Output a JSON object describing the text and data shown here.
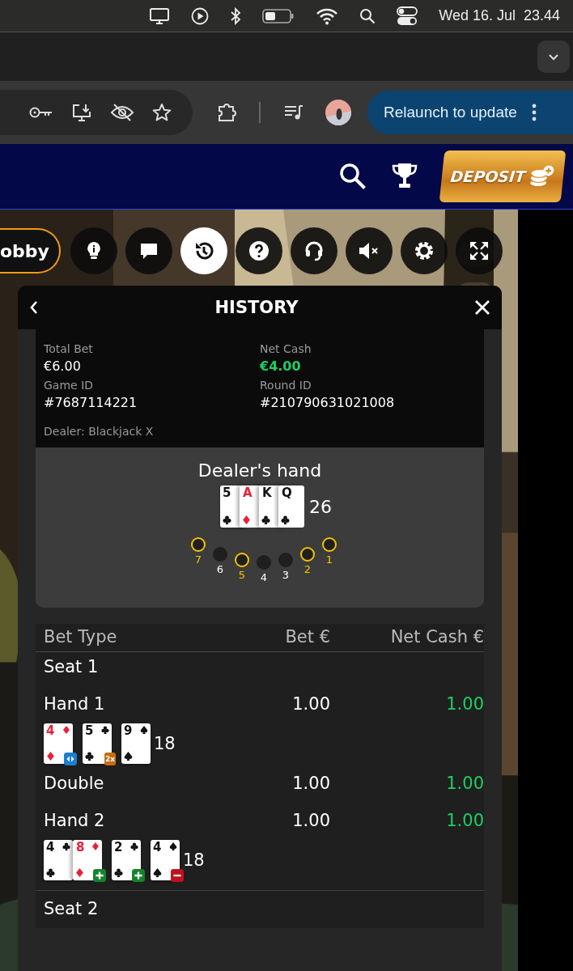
{
  "menubar": {
    "date": "Wed 16. Jul",
    "time": "23.44"
  },
  "browser": {
    "update_button": "Relaunch to update"
  },
  "site_header": {
    "deposit_button": "DEPOSIT"
  },
  "game_toolbar": {
    "lobby_button": "obby",
    "buttons": [
      {
        "kind": "tips",
        "selected": false
      },
      {
        "kind": "chat",
        "selected": false
      },
      {
        "kind": "history",
        "selected": true
      },
      {
        "kind": "help",
        "selected": false
      },
      {
        "kind": "support",
        "selected": false
      },
      {
        "kind": "sound",
        "selected": false
      },
      {
        "kind": "settings",
        "selected": false
      },
      {
        "kind": "fullscreen",
        "selected": false
      }
    ]
  },
  "history": {
    "title": "HISTORY",
    "summary": [
      {
        "label": "Total Bet",
        "value": "€6.00",
        "positive": false
      },
      {
        "label": "Net Cash",
        "value": "€4.00",
        "positive": true
      },
      {
        "label": "Game ID",
        "value": "#7687114221",
        "positive": false
      },
      {
        "label": "Round ID",
        "value": "#210790631021008",
        "positive": false
      }
    ],
    "dealer_line": "Dealer: Blackjack X",
    "dealer_hand": {
      "title": "Dealer's hand",
      "total": "26",
      "cards": [
        {
          "rank": "5",
          "kind": "clubs",
          "overlap": false
        },
        {
          "rank": "A",
          "kind": "diamonds",
          "overlap": true
        },
        {
          "rank": "K",
          "kind": "clubs",
          "overlap": true
        },
        {
          "rank": "Q",
          "kind": "clubs",
          "overlap": true
        }
      ],
      "seats": [
        {
          "number": "7",
          "active": true
        },
        {
          "number": "6",
          "active": false
        },
        {
          "number": "5",
          "active": true
        },
        {
          "number": "4",
          "active": false
        },
        {
          "number": "3",
          "active": false
        },
        {
          "number": "2",
          "active": true
        },
        {
          "number": "1",
          "active": true
        }
      ]
    },
    "table": {
      "columns": [
        "Bet Type",
        "Bet €",
        "Net Cash €"
      ],
      "rows": [
        {
          "kind": "seat",
          "label": "Seat 1"
        },
        {
          "kind": "bet",
          "label": "Hand 1",
          "bet": "1.00",
          "net": "1.00",
          "positive": true
        },
        {
          "kind": "cards",
          "total": "18",
          "cards": [
            {
              "rank": "4",
              "kind": "diamonds",
              "overlap": false,
              "badge": {
                "kind": "split"
              }
            },
            {
              "rank": "5",
              "kind": "clubs",
              "overlap": false,
              "badge": {
                "kind": "double",
                "text": "2x"
              }
            },
            {
              "rank": "9",
              "kind": "spades",
              "overlap": false
            }
          ]
        },
        {
          "kind": "bet",
          "label": "Double",
          "bet": "1.00",
          "net": "1.00",
          "positive": true
        },
        {
          "kind": "bet",
          "label": "Hand 2",
          "bet": "1.00",
          "net": "1.00",
          "positive": true
        },
        {
          "kind": "cards",
          "total": "18",
          "cards": [
            {
              "rank": "4",
              "kind": "clubs",
              "overlap": false
            },
            {
              "rank": "8",
              "kind": "diamonds",
              "overlap": true,
              "badge": {
                "kind": "plus"
              }
            },
            {
              "rank": "2",
              "kind": "clubs",
              "overlap": false,
              "badge": {
                "kind": "plus"
              }
            },
            {
              "rank": "4",
              "kind": "spades",
              "overlap": false,
              "badge": {
                "kind": "minus"
              }
            }
          ]
        },
        {
          "kind": "seat",
          "label": "Seat 2"
        }
      ]
    }
  }
}
